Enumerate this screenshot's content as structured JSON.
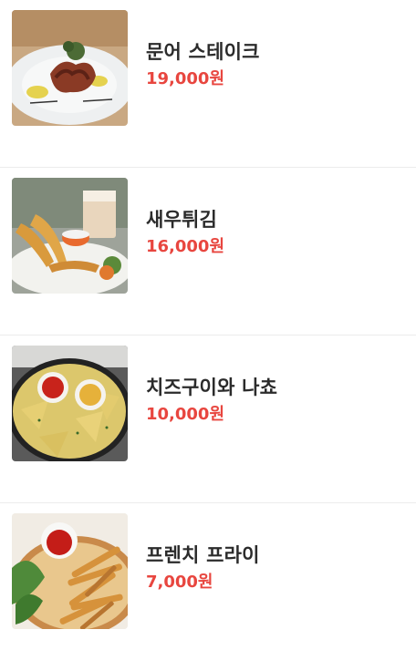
{
  "menu": {
    "items": [
      {
        "name": "문어 스테이크",
        "price": "19,000원",
        "image_icon": "octopus-steak-photo"
      },
      {
        "name": "새우튀김",
        "price": "16,000원",
        "image_icon": "fried-shrimp-photo"
      },
      {
        "name": "치즈구이와 나쵸",
        "price": "10,000원",
        "image_icon": "cheese-nachos-photo"
      },
      {
        "name": "프렌치 프라이",
        "price": "7,000원",
        "image_icon": "french-fries-photo"
      }
    ],
    "colors": {
      "price": "#e8463f",
      "name": "#2b2b2b",
      "divider": "#ececec"
    }
  }
}
